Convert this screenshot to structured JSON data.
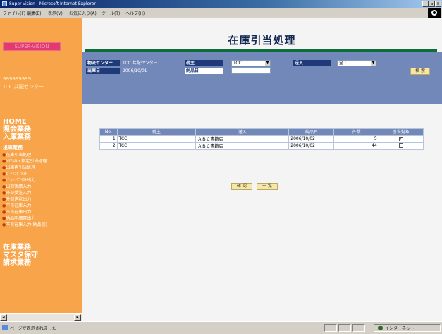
{
  "window": {
    "title": "Super-Vision - Microsoft Internet Explorer",
    "controls": [
      "_",
      "▫",
      "×"
    ]
  },
  "menubar": {
    "items": [
      "ファイル(F)",
      "編集(E)",
      "表示(V)",
      "お気に入り(A)",
      "ツール(T)",
      "ヘルプ(H)"
    ]
  },
  "sidebar": {
    "user_id": "999999999",
    "center_name": "TCC 共配センター",
    "nav_home": "HOME",
    "nav_inquiry": "照会業務",
    "nav_receiving": "入庫業務",
    "shipping_heading": "出庫業務",
    "shipping_items": [
      "在庫引当処理",
      "ｼﾘｱﾙNo.指定引当処理",
      "出庫再引当処理",
      "ﾋﾟｯｷﾝｸﾞﾘｽﾄ",
      "ﾋﾟｯｷﾝｸﾞﾘｽﾄ出力",
      "出荷実績入力",
      "外部受注入力",
      "外部送状出力",
      "不良在庫入力",
      "不良在庫出力",
      "納品明細書出力",
      "不良在庫入力(納品別)"
    ],
    "nav_stock": "在庫業務",
    "nav_master": "マスタ保守",
    "nav_billing": "請求業務",
    "bullet": "●"
  },
  "main": {
    "title": "在庫引当処理",
    "form": {
      "center_label": "物流センター",
      "center_value": "TCC 共配センター",
      "shipper_label": "荷主",
      "shipper_value": "TCC",
      "dest_label": "送入",
      "dest_value": "全て",
      "ship_date_label": "出庫日",
      "ship_date_value": "2006/10/01",
      "delivery_date_label": "納品日",
      "delivery_date_value": "",
      "search_button": "検 索"
    },
    "table": {
      "headers": [
        "No.",
        "荷主",
        "送入",
        "納品日",
        "件数",
        "引当対象"
      ],
      "rows": [
        {
          "no": "1",
          "shipper": "TCC",
          "dest": "ＡＢＣ書籍店",
          "date": "2006/10/02",
          "count": "5",
          "checked": true
        },
        {
          "no": "2",
          "shipper": "TCC",
          "dest": "ＡＢＣ書籍店",
          "date": "2006/10/02",
          "count": "44",
          "checked": false
        }
      ]
    },
    "confirm_button": "確 認",
    "back_button": "一 覧"
  },
  "statusbar": {
    "text": "ページが表示されました",
    "zone": "インターネット"
  },
  "colors": {
    "sidebar": "#f7a44a",
    "form_panel": "#7288b8",
    "label_bg": "#1e3a78",
    "title_bar_accent": "#0e6b3a",
    "button": "#f7e7a6"
  }
}
